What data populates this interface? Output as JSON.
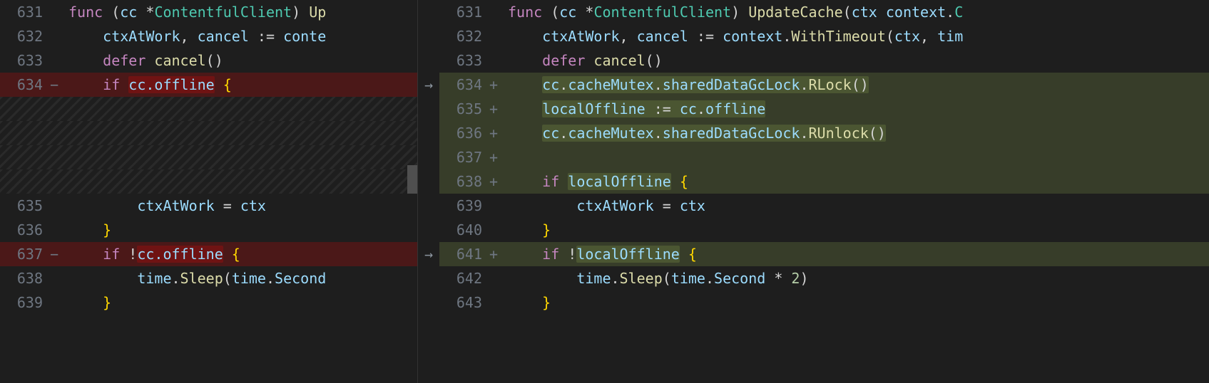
{
  "left": {
    "lines": [
      {
        "num": "631",
        "marker": "",
        "kind": "normal",
        "tokens": [
          {
            "t": "func ",
            "c": "kw"
          },
          {
            "t": "(",
            "c": "paren"
          },
          {
            "t": "cc ",
            "c": "ident"
          },
          {
            "t": "*",
            "c": "star"
          },
          {
            "t": "ContentfulClient",
            "c": "type"
          },
          {
            "t": ") ",
            "c": "paren"
          },
          {
            "t": "Up",
            "c": "func"
          }
        ]
      },
      {
        "num": "632",
        "marker": "",
        "kind": "normal",
        "indent": 1,
        "tokens": [
          {
            "t": "ctxAtWork",
            "c": "ident"
          },
          {
            "t": ", ",
            "c": "punct"
          },
          {
            "t": "cancel",
            "c": "ident"
          },
          {
            "t": " := ",
            "c": "op"
          },
          {
            "t": "conte",
            "c": "ident"
          }
        ]
      },
      {
        "num": "633",
        "marker": "",
        "kind": "normal",
        "indent": 1,
        "tokens": [
          {
            "t": "defer ",
            "c": "kw"
          },
          {
            "t": "cancel",
            "c": "func"
          },
          {
            "t": "()",
            "c": "paren"
          }
        ]
      },
      {
        "num": "634",
        "marker": "−",
        "kind": "deleted",
        "indent": 1,
        "tokens": [
          {
            "t": "if ",
            "c": "kw"
          },
          {
            "t": "cc.offline",
            "c": "ident",
            "hl": "word-deleted"
          },
          {
            "t": " {",
            "c": "brace"
          }
        ]
      },
      {
        "num": "",
        "marker": "",
        "kind": "diagonal"
      },
      {
        "num": "",
        "marker": "",
        "kind": "diagonal"
      },
      {
        "num": "",
        "marker": "",
        "kind": "diagonal"
      },
      {
        "num": "",
        "marker": "",
        "kind": "diagonal"
      },
      {
        "num": "635",
        "marker": "",
        "kind": "normal",
        "indent": 2,
        "tokens": [
          {
            "t": "ctxAtWork",
            "c": "ident"
          },
          {
            "t": " = ",
            "c": "op"
          },
          {
            "t": "ctx",
            "c": "ident"
          }
        ]
      },
      {
        "num": "636",
        "marker": "",
        "kind": "normal",
        "indent": 1,
        "tokens": [
          {
            "t": "}",
            "c": "brace"
          }
        ]
      },
      {
        "num": "637",
        "marker": "−",
        "kind": "deleted",
        "indent": 1,
        "tokens": [
          {
            "t": "if ",
            "c": "kw"
          },
          {
            "t": "!",
            "c": "op"
          },
          {
            "t": "cc.offline",
            "c": "ident",
            "hl": "word-deleted"
          },
          {
            "t": " {",
            "c": "brace"
          }
        ]
      },
      {
        "num": "638",
        "marker": "",
        "kind": "normal",
        "indent": 2,
        "tokens": [
          {
            "t": "time",
            "c": "ident"
          },
          {
            "t": ".",
            "c": "punct"
          },
          {
            "t": "Sleep",
            "c": "func"
          },
          {
            "t": "(",
            "c": "paren"
          },
          {
            "t": "time",
            "c": "ident"
          },
          {
            "t": ".",
            "c": "punct"
          },
          {
            "t": "Second",
            "c": "ident"
          }
        ]
      },
      {
        "num": "639",
        "marker": "",
        "kind": "normal",
        "indent": 1,
        "tokens": [
          {
            "t": "}",
            "c": "brace"
          }
        ]
      }
    ]
  },
  "right": {
    "lines": [
      {
        "num": "631",
        "marker": "",
        "kind": "normal",
        "tokens": [
          {
            "t": "func ",
            "c": "kw"
          },
          {
            "t": "(",
            "c": "paren"
          },
          {
            "t": "cc ",
            "c": "ident"
          },
          {
            "t": "*",
            "c": "star"
          },
          {
            "t": "ContentfulClient",
            "c": "type"
          },
          {
            "t": ") ",
            "c": "paren"
          },
          {
            "t": "UpdateCache",
            "c": "func"
          },
          {
            "t": "(",
            "c": "paren"
          },
          {
            "t": "ctx ",
            "c": "ident"
          },
          {
            "t": "context",
            "c": "ident"
          },
          {
            "t": ".",
            "c": "punct"
          },
          {
            "t": "C",
            "c": "type"
          }
        ]
      },
      {
        "num": "632",
        "marker": "",
        "kind": "normal",
        "indent": 1,
        "tokens": [
          {
            "t": "ctxAtWork",
            "c": "ident"
          },
          {
            "t": ", ",
            "c": "punct"
          },
          {
            "t": "cancel",
            "c": "ident"
          },
          {
            "t": " := ",
            "c": "op"
          },
          {
            "t": "context",
            "c": "ident"
          },
          {
            "t": ".",
            "c": "punct"
          },
          {
            "t": "WithTimeout",
            "c": "func"
          },
          {
            "t": "(",
            "c": "paren"
          },
          {
            "t": "ctx",
            "c": "ident"
          },
          {
            "t": ", ",
            "c": "punct"
          },
          {
            "t": "tim",
            "c": "ident"
          }
        ]
      },
      {
        "num": "633",
        "marker": "",
        "kind": "normal",
        "indent": 1,
        "tokens": [
          {
            "t": "defer ",
            "c": "kw"
          },
          {
            "t": "cancel",
            "c": "func"
          },
          {
            "t": "()",
            "c": "paren"
          }
        ]
      },
      {
        "num": "634",
        "marker": "+",
        "kind": "added",
        "indent": 1,
        "tokens": [
          {
            "t": "cc",
            "c": "ident"
          },
          {
            "t": ".",
            "c": "punct"
          },
          {
            "t": "cacheMutex",
            "c": "field"
          },
          {
            "t": ".",
            "c": "punct"
          },
          {
            "t": "sharedDataGcLock",
            "c": "field"
          },
          {
            "t": ".",
            "c": "punct"
          },
          {
            "t": "RLock",
            "c": "func"
          },
          {
            "t": "()",
            "c": "paren"
          }
        ],
        "hlrun": true
      },
      {
        "num": "635",
        "marker": "+",
        "kind": "added",
        "indent": 1,
        "tokens": [
          {
            "t": "localOffline",
            "c": "ident"
          },
          {
            "t": " := ",
            "c": "op"
          },
          {
            "t": "cc",
            "c": "ident"
          },
          {
            "t": ".",
            "c": "punct"
          },
          {
            "t": "offline",
            "c": "field"
          }
        ],
        "hlrun": true
      },
      {
        "num": "636",
        "marker": "+",
        "kind": "added",
        "indent": 1,
        "tokens": [
          {
            "t": "cc",
            "c": "ident"
          },
          {
            "t": ".",
            "c": "punct"
          },
          {
            "t": "cacheMutex",
            "c": "field"
          },
          {
            "t": ".",
            "c": "punct"
          },
          {
            "t": "sharedDataGcLock",
            "c": "field"
          },
          {
            "t": ".",
            "c": "punct"
          },
          {
            "t": "RUnlock",
            "c": "func"
          },
          {
            "t": "()",
            "c": "paren"
          }
        ],
        "hlrun": true
      },
      {
        "num": "637",
        "marker": "+",
        "kind": "added-empty",
        "indent": 0,
        "tokens": []
      },
      {
        "num": "638",
        "marker": "+",
        "kind": "added",
        "indent": 1,
        "tokens": [
          {
            "t": "if ",
            "c": "kw"
          },
          {
            "t": "localOffline",
            "c": "ident",
            "hl": "word-added"
          },
          {
            "t": " {",
            "c": "brace"
          }
        ]
      },
      {
        "num": "639",
        "marker": "",
        "kind": "normal",
        "indent": 2,
        "tokens": [
          {
            "t": "ctxAtWork",
            "c": "ident"
          },
          {
            "t": " = ",
            "c": "op"
          },
          {
            "t": "ctx",
            "c": "ident"
          }
        ]
      },
      {
        "num": "640",
        "marker": "",
        "kind": "normal",
        "indent": 1,
        "tokens": [
          {
            "t": "}",
            "c": "brace"
          }
        ]
      },
      {
        "num": "641",
        "marker": "+",
        "kind": "added",
        "indent": 1,
        "tokens": [
          {
            "t": "if ",
            "c": "kw"
          },
          {
            "t": "!",
            "c": "op"
          },
          {
            "t": "localOffline",
            "c": "ident",
            "hl": "word-added"
          },
          {
            "t": " {",
            "c": "brace"
          }
        ]
      },
      {
        "num": "642",
        "marker": "",
        "kind": "normal",
        "indent": 2,
        "tokens": [
          {
            "t": "time",
            "c": "ident"
          },
          {
            "t": ".",
            "c": "punct"
          },
          {
            "t": "Sleep",
            "c": "func"
          },
          {
            "t": "(",
            "c": "paren"
          },
          {
            "t": "time",
            "c": "ident"
          },
          {
            "t": ".",
            "c": "punct"
          },
          {
            "t": "Second",
            "c": "ident"
          },
          {
            "t": " * ",
            "c": "op"
          },
          {
            "t": "2",
            "c": "num"
          },
          {
            "t": ")",
            "c": "paren"
          }
        ]
      },
      {
        "num": "643",
        "marker": "",
        "kind": "normal",
        "indent": 1,
        "tokens": [
          {
            "t": "}",
            "c": "brace"
          }
        ]
      }
    ]
  },
  "arrows": [
    false,
    false,
    false,
    true,
    false,
    false,
    false,
    false,
    false,
    false,
    true,
    false,
    false
  ]
}
